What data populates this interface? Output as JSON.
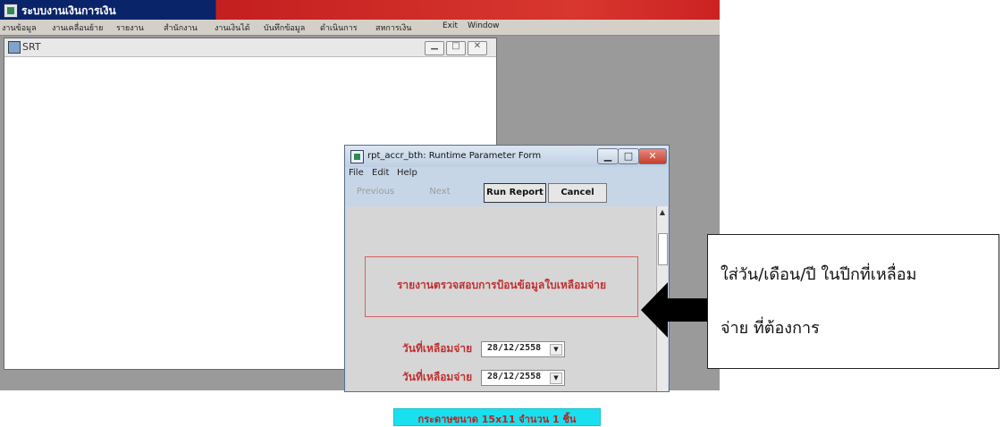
{
  "app": {
    "title": "ระบบงานเงินการเงิน",
    "menu": [
      "งานข้อมูล",
      "งานเคลื่อนย้าย",
      "รายงาน",
      "สำนักงาน",
      "งานเงินได้",
      "บันทึกข้อมูล",
      "ดำเนินการ",
      "สหการเงิน",
      "Exit",
      "Window"
    ]
  },
  "mdi": {
    "title": "SRT"
  },
  "dialog": {
    "title": "rpt_accr_bth: Runtime Parameter Form",
    "menu": [
      "File",
      "Edit",
      "Help"
    ],
    "toolbar": {
      "previous": "Previous",
      "next": "Next",
      "run_report": "Run Report",
      "cancel": "Cancel"
    },
    "report_title": "รายงานตรวจสอบการป้อนข้อมูลใบเหลือมจ่าย",
    "params": [
      {
        "label": "วันที่เหลือมจ่าย",
        "value": "28/12/2558"
      },
      {
        "label": "วันที่เหลือมจ่าย",
        "value": "28/12/2558"
      }
    ],
    "paper_note": "กระดาษขนาด 15x11 จำนวน 1 ชิ้น"
  },
  "callout": {
    "line1": "ใส่วัน/เดือน/ปี ในปีกที่เหลื่อม",
    "line2": "จ่าย ที่ต้องการ"
  }
}
